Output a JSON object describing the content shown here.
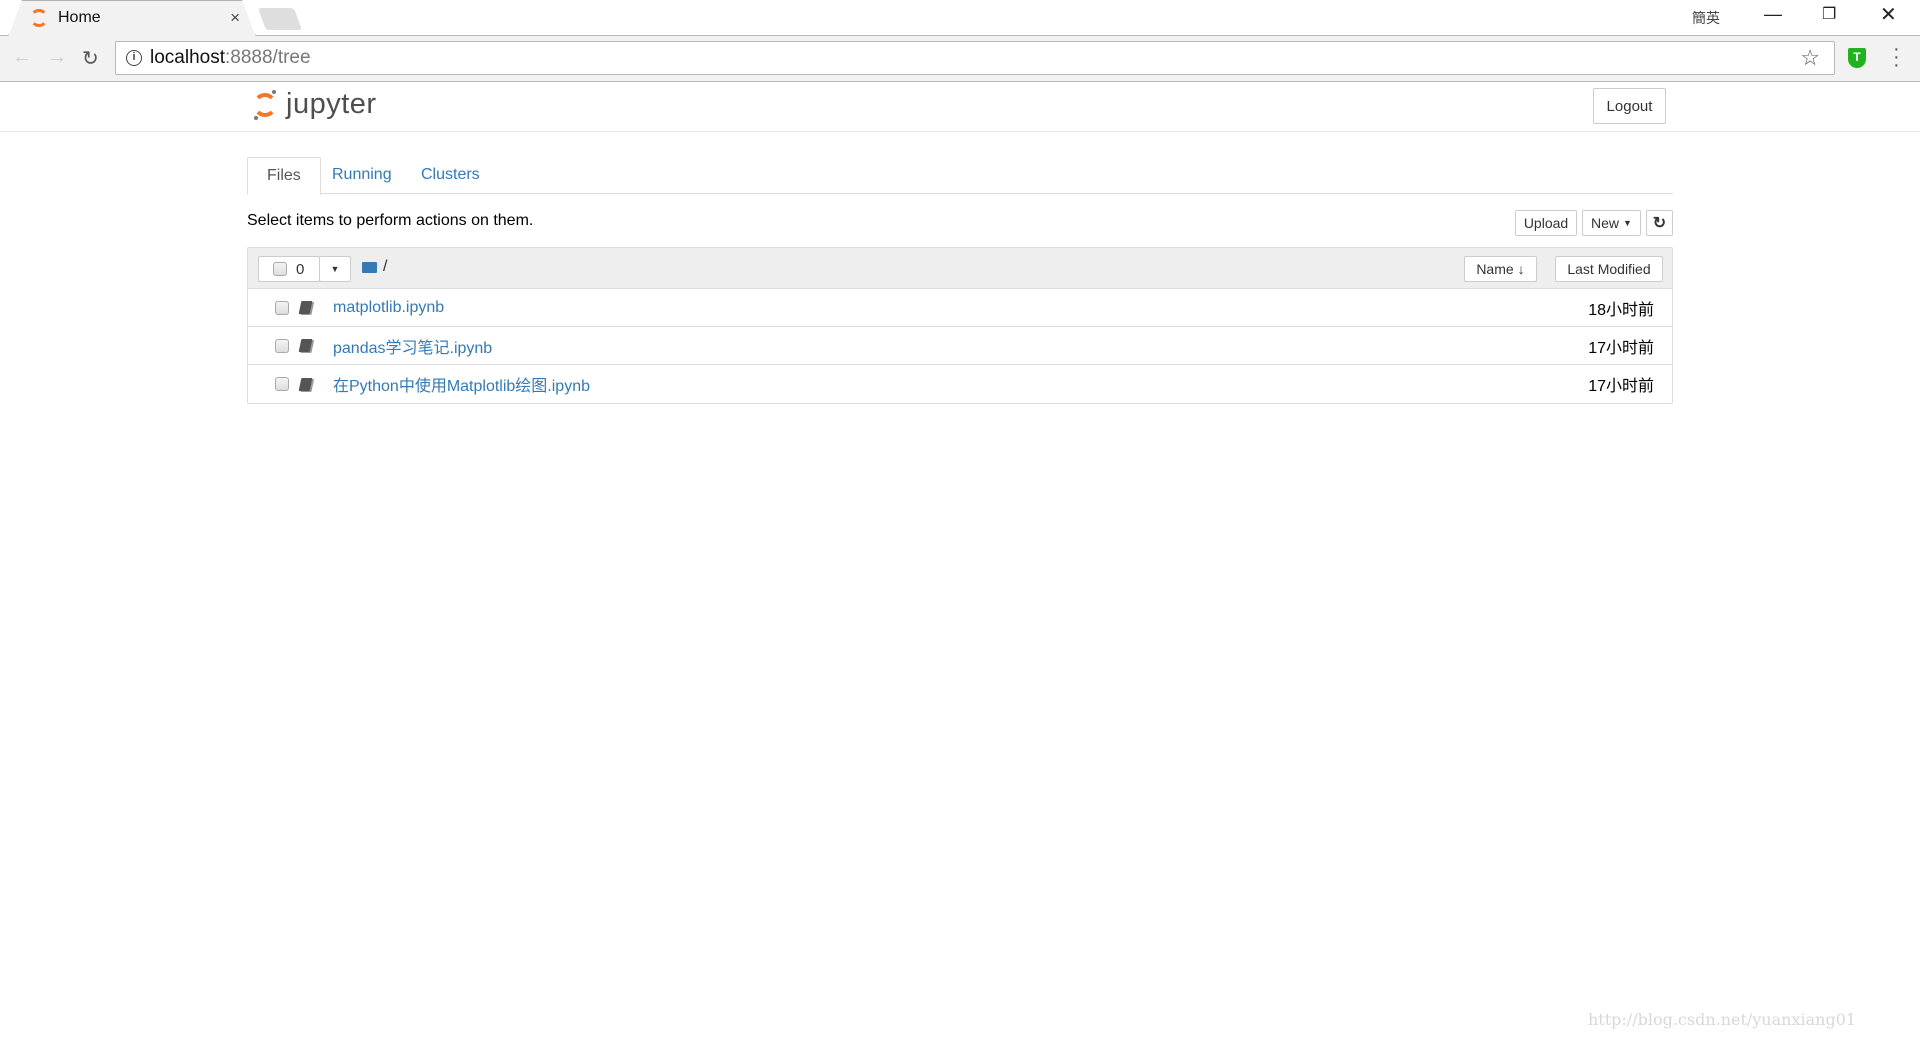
{
  "browser": {
    "tab_title": "Home",
    "tab_close": "×",
    "ime_indicator": "簡英",
    "url_host": "localhost",
    "url_rest": ":8888/tree",
    "icons": [
      "back-icon",
      "forward-icon",
      "reload-icon",
      "info-icon",
      "star-icon",
      "shield-extension-icon",
      "menu-icon"
    ],
    "shield_letter": "T"
  },
  "header": {
    "logo_text": "jupyter",
    "logout_label": "Logout"
  },
  "tabs": [
    {
      "label": "Files",
      "active": true
    },
    {
      "label": "Running"
    },
    {
      "label": "Clusters"
    }
  ],
  "toolbar": {
    "hint": "Select items to perform actions on them.",
    "upload_label": "Upload",
    "new_label": "New",
    "refresh_icon": "refresh-icon"
  },
  "list_header": {
    "selected_count": "0",
    "path": "/",
    "name_sort_label": "Name",
    "last_modified_label": "Last Modified"
  },
  "files": [
    {
      "name": "matplotlib.ipynb",
      "modified": "18小时前"
    },
    {
      "name": "pandas学习笔记.ipynb",
      "modified": "17小时前"
    },
    {
      "name": "在Python中使用Matplotlib绘图.ipynb",
      "modified": "17小时前"
    }
  ],
  "watermark": "http://blog.csdn.net/yuanxiang01",
  "colors": {
    "brand": "#f37726",
    "link": "#337ab7"
  }
}
